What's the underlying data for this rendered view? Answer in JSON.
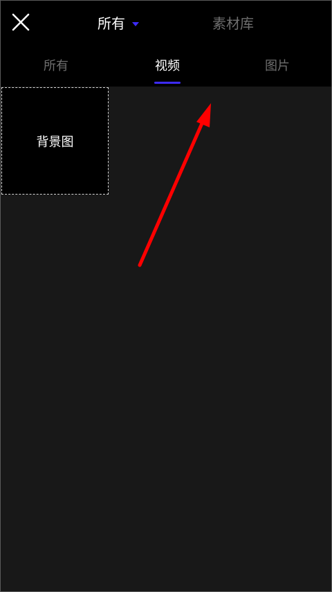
{
  "header": {
    "source_select_label": "所有",
    "library_label": "素材库"
  },
  "tabs": [
    {
      "label": "所有",
      "active": false
    },
    {
      "label": "视频",
      "active": true
    },
    {
      "label": "图片",
      "active": false
    }
  ],
  "grid": {
    "tiles": [
      {
        "label": "背景图"
      }
    ]
  },
  "colors": {
    "accent": "#3d2bff",
    "annotation_arrow": "#ff0000",
    "background": "#181818"
  }
}
